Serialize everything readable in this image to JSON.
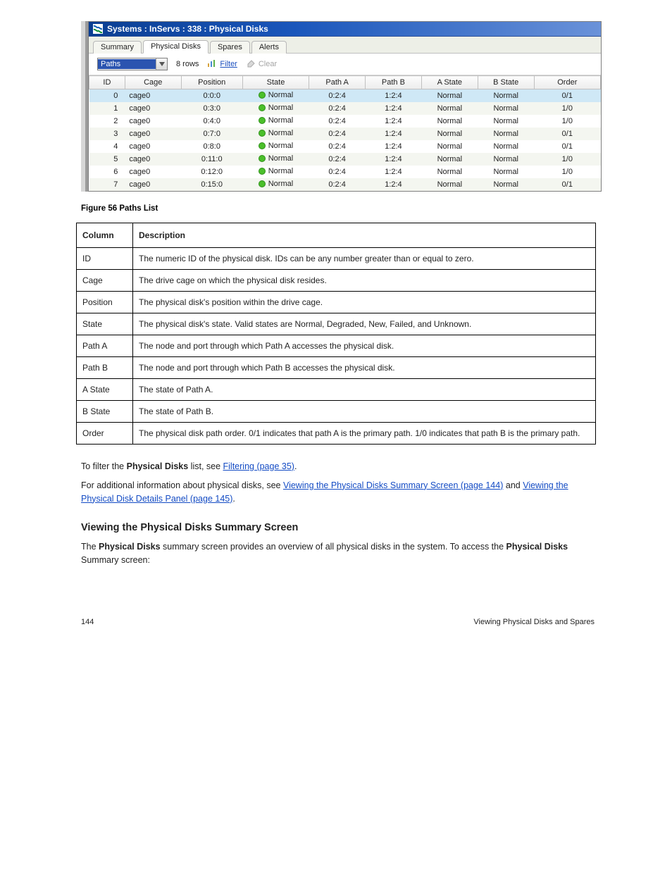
{
  "window": {
    "title": "Systems : InServs : 338 : Physical Disks"
  },
  "tabs": {
    "items": [
      {
        "label": "Summary",
        "active": false
      },
      {
        "label": "Physical Disks",
        "active": true
      },
      {
        "label": "Spares",
        "active": false
      },
      {
        "label": "Alerts",
        "active": false
      }
    ]
  },
  "toolbar": {
    "combo_selection": "Paths",
    "rows_text": "8 rows",
    "filter_label": "Filter",
    "clear_label": "Clear"
  },
  "disk_columns": [
    "ID",
    "Cage",
    "Position",
    "State",
    "Path A",
    "Path B",
    "A State",
    "B State",
    "Order"
  ],
  "disk_rows": [
    {
      "id": "0",
      "cage": "cage0",
      "pos": "0:0:0",
      "state": "Normal",
      "pa": "0:2:4",
      "pb": "1:2:4",
      "as": "Normal",
      "bs": "Normal",
      "order": "0/1",
      "sel": true
    },
    {
      "id": "1",
      "cage": "cage0",
      "pos": "0:3:0",
      "state": "Normal",
      "pa": "0:2:4",
      "pb": "1:2:4",
      "as": "Normal",
      "bs": "Normal",
      "order": "1/0",
      "sel": false
    },
    {
      "id": "2",
      "cage": "cage0",
      "pos": "0:4:0",
      "state": "Normal",
      "pa": "0:2:4",
      "pb": "1:2:4",
      "as": "Normal",
      "bs": "Normal",
      "order": "1/0",
      "sel": false
    },
    {
      "id": "3",
      "cage": "cage0",
      "pos": "0:7:0",
      "state": "Normal",
      "pa": "0:2:4",
      "pb": "1:2:4",
      "as": "Normal",
      "bs": "Normal",
      "order": "0/1",
      "sel": false
    },
    {
      "id": "4",
      "cage": "cage0",
      "pos": "0:8:0",
      "state": "Normal",
      "pa": "0:2:4",
      "pb": "1:2:4",
      "as": "Normal",
      "bs": "Normal",
      "order": "0/1",
      "sel": false
    },
    {
      "id": "5",
      "cage": "cage0",
      "pos": "0:11:0",
      "state": "Normal",
      "pa": "0:2:4",
      "pb": "1:2:4",
      "as": "Normal",
      "bs": "Normal",
      "order": "1/0",
      "sel": false
    },
    {
      "id": "6",
      "cage": "cage0",
      "pos": "0:12:0",
      "state": "Normal",
      "pa": "0:2:4",
      "pb": "1:2:4",
      "as": "Normal",
      "bs": "Normal",
      "order": "1/0",
      "sel": false
    },
    {
      "id": "7",
      "cage": "cage0",
      "pos": "0:15:0",
      "state": "Normal",
      "pa": "0:2:4",
      "pb": "1:2:4",
      "as": "Normal",
      "bs": "Normal",
      "order": "0/1",
      "sel": false
    }
  ],
  "caption": "Figure 56 Paths List",
  "desc_head": {
    "col": "Column",
    "desc": "Description"
  },
  "desc_rows": [
    {
      "c": "ID",
      "d": "The numeric ID of the physical disk. IDs can be any number greater than or equal to zero."
    },
    {
      "c": "Cage",
      "d": "The drive cage on which the physical disk resides."
    },
    {
      "c": "Position",
      "d": "The physical disk's position within the drive cage."
    },
    {
      "c": "State",
      "d": "The physical disk's state. Valid states are Normal, Degraded, New, Failed, and Unknown."
    },
    {
      "c": "Path A",
      "d": "The node and port through which Path A accesses the physical disk."
    },
    {
      "c": "Path B",
      "d": "The node and port through which Path B accesses the physical disk."
    },
    {
      "c": "A State",
      "d": "The state of Path A."
    },
    {
      "c": "B State",
      "d": "The state of Path B."
    },
    {
      "c": "Order",
      "d": "The physical disk path order. 0/1 indicates that path A is the primary path. 1/0 indicates that path B is the primary path."
    }
  ],
  "prose": {
    "p1a": "To filter the ",
    "p1b": "Physical Disks",
    "p1c": " list, see ",
    "p1link": "Filtering (page 35)",
    "p1d": ".",
    "p2a": "For additional information about physical disks, see ",
    "p2link1": "Viewing the Physical Disks Summary Screen (page 144)",
    "p2mid": " and ",
    "p2link2": "Viewing the Physical Disk Details Panel (page 145)",
    "p2end": "."
  },
  "h2": "Viewing the Physical Disks Summary Screen",
  "p3": {
    "a": "The ",
    "b": "Physical Disks",
    "c": " summary screen provides an overview of all physical disks in the system. To access the ",
    "d": "Physical Disks",
    "e": " Summary screen:"
  },
  "footer": {
    "left": "144",
    "right": "Viewing Physical Disks and Spares"
  }
}
